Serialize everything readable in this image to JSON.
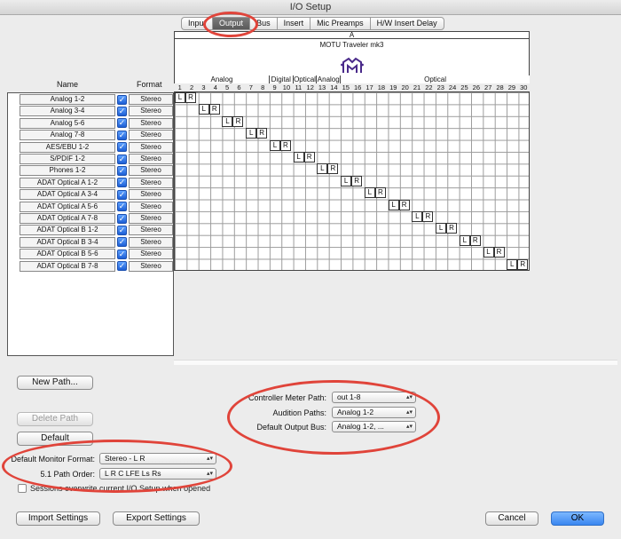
{
  "window": {
    "title": "I/O Setup"
  },
  "tabs": [
    {
      "label": "Input",
      "active": false
    },
    {
      "label": "Output",
      "active": true
    },
    {
      "label": "Bus",
      "active": false
    },
    {
      "label": "Insert",
      "active": false
    },
    {
      "label": "Mic Preamps",
      "active": false
    },
    {
      "label": "H/W Insert Delay",
      "active": false
    }
  ],
  "columns": {
    "name": "Name",
    "format": "Format"
  },
  "device": {
    "section": "A",
    "name": "MOTU Traveler mk3",
    "logo_icon": "motu-logo-icon"
  },
  "groups": [
    {
      "label": "Analog",
      "channels": 8
    },
    {
      "label": "Digital",
      "channels": 2
    },
    {
      "label": "Optical",
      "channels": 2
    },
    {
      "label": "Analog",
      "channels": 2
    },
    {
      "label": "Optical",
      "channels": 16
    }
  ],
  "channel_numbers": [
    "1",
    "2",
    "3",
    "4",
    "5",
    "6",
    "7",
    "8",
    "9",
    "10",
    "11",
    "12",
    "13",
    "14",
    "15",
    "16",
    "17",
    "18",
    "19",
    "20",
    "21",
    "22",
    "23",
    "24",
    "25",
    "26",
    "27",
    "28",
    "29",
    "30"
  ],
  "paths": [
    {
      "name": "Analog 1-2",
      "checked": true,
      "format": "Stereo",
      "l_channel": 1
    },
    {
      "name": "Analog 3-4",
      "checked": true,
      "format": "Stereo",
      "l_channel": 3
    },
    {
      "name": "Analog 5-6",
      "checked": true,
      "format": "Stereo",
      "l_channel": 5
    },
    {
      "name": "Analog 7-8",
      "checked": true,
      "format": "Stereo",
      "l_channel": 7
    },
    {
      "name": "AES/EBU 1-2",
      "checked": true,
      "format": "Stereo",
      "l_channel": 9
    },
    {
      "name": "S/PDIF 1-2",
      "checked": true,
      "format": "Stereo",
      "l_channel": 11
    },
    {
      "name": "Phones 1-2",
      "checked": true,
      "format": "Stereo",
      "l_channel": 13
    },
    {
      "name": "ADAT Optical A 1-2",
      "checked": true,
      "format": "Stereo",
      "l_channel": 15
    },
    {
      "name": "ADAT Optical A 3-4",
      "checked": true,
      "format": "Stereo",
      "l_channel": 17
    },
    {
      "name": "ADAT Optical A 5-6",
      "checked": true,
      "format": "Stereo",
      "l_channel": 19
    },
    {
      "name": "ADAT Optical A 7-8",
      "checked": true,
      "format": "Stereo",
      "l_channel": 21
    },
    {
      "name": "ADAT Optical B 1-2",
      "checked": true,
      "format": "Stereo",
      "l_channel": 23
    },
    {
      "name": "ADAT Optical B 3-4",
      "checked": true,
      "format": "Stereo",
      "l_channel": 25
    },
    {
      "name": "ADAT Optical B 5-6",
      "checked": true,
      "format": "Stereo",
      "l_channel": 27
    },
    {
      "name": "ADAT Optical B 7-8",
      "checked": true,
      "format": "Stereo",
      "l_channel": 29
    }
  ],
  "assign_labels": {
    "left": "L",
    "right": "R"
  },
  "buttons": {
    "new_path": "New Path...",
    "delete_path": "Delete Path",
    "default": "Default",
    "import": "Import Settings",
    "export": "Export Settings",
    "cancel": "Cancel",
    "ok": "OK"
  },
  "settings": {
    "default_monitor_format_label": "Default Monitor Format:",
    "default_monitor_format_value": "Stereo - L R",
    "path_order_label": "5.1 Path Order:",
    "path_order_value": "L R C LFE Ls Rs",
    "sessions_overwrite_label": "Sessions overwrite current I/O Setup when opened",
    "sessions_overwrite_checked": false,
    "controller_meter_label": "Controller Meter Path:",
    "controller_meter_value": "out 1-8",
    "audition_label": "Audition Paths:",
    "audition_value": "Analog 1-2",
    "default_output_label": "Default Output Bus:",
    "default_output_value": "Analog 1-2, ..."
  },
  "annotation_color": "#e0443a"
}
